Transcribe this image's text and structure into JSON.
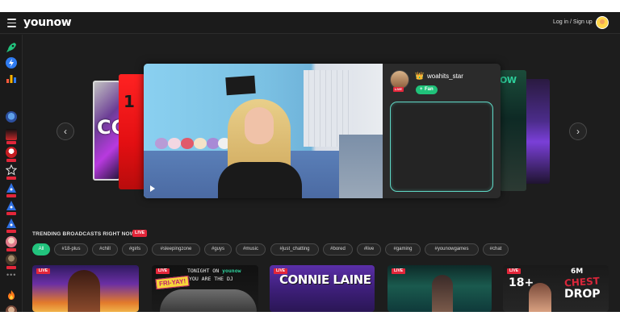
{
  "header": {
    "logo": "younow",
    "login_label": "Log in / Sign up"
  },
  "sidebar": {
    "items": [
      {
        "icon": "rocket-icon",
        "color": "#22c37d"
      },
      {
        "icon": "bolt-icon",
        "color": "#2f7bf0"
      },
      {
        "icon": "bars-icon",
        "color": "#ffb400"
      },
      {
        "icon": "user-avatar",
        "live": false
      },
      {
        "icon": "user-avatar",
        "live": true
      },
      {
        "icon": "user-avatar",
        "live": true
      },
      {
        "icon": "user-avatar",
        "live": true
      },
      {
        "icon": "user-avatar",
        "live": true
      },
      {
        "icon": "user-avatar",
        "live": true
      },
      {
        "icon": "user-avatar",
        "live": true
      },
      {
        "icon": "user-avatar",
        "live": true
      },
      {
        "icon": "user-avatar",
        "live": true
      }
    ],
    "more": "•••",
    "bottom_icon": "flame-icon"
  },
  "carousel": {
    "left_card_text": "CC",
    "left_card2_text": "1",
    "right_card_text": "OW",
    "featured": {
      "username": "woahits_star",
      "live_label": "LIVE",
      "fan_label": "Fan"
    }
  },
  "trending": {
    "title": "TRENDING BROADCASTS RIGHT NOW",
    "live_label": "LIVE",
    "tags": [
      "All",
      "#18-plus",
      "#chill",
      "#girls",
      "#sleepingzone",
      "#guys",
      "#music",
      "#just_chatting",
      "#bored",
      "#live",
      "#gaming",
      "#younowgames",
      "#chat"
    ],
    "active_tag": "All",
    "cards": [
      {
        "live": "LIVE"
      },
      {
        "live": "LIVE",
        "line1_a": "TONIGHT ON",
        "line1_b": "younow",
        "line2": "YOU ARE THE DJ",
        "badge": "FRI-YAY!"
      },
      {
        "live": "LIVE",
        "headline": "CONNIE LAINE"
      },
      {
        "live": "LIVE"
      },
      {
        "live": "LIVE",
        "line1": "6M",
        "line2": "CHEST",
        "line3": "DROP",
        "plus": "18+"
      }
    ]
  },
  "colors": {
    "accent": "#22c37d",
    "live": "#e3263a",
    "background": "#1d1d1d"
  }
}
